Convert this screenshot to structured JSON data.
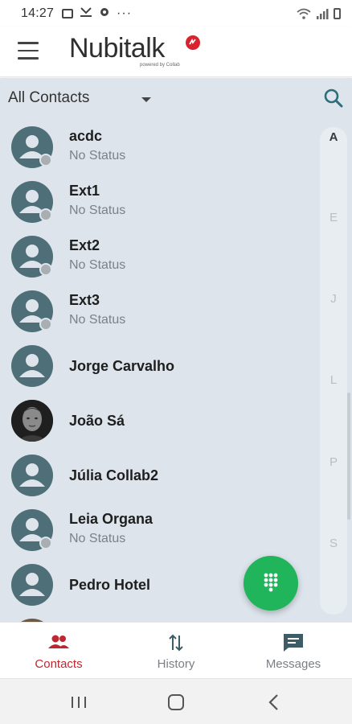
{
  "status_bar": {
    "time": "14:27",
    "more_indicator": "···"
  },
  "header": {
    "logo_text": "Nubitalk",
    "logo_tagline": "powered by Collab"
  },
  "filter": {
    "label": "All Contacts"
  },
  "contacts": [
    {
      "name": "acdc",
      "status": "No Status"
    },
    {
      "name": "Ext1",
      "status": "No Status"
    },
    {
      "name": "Ext2",
      "status": "No Status"
    },
    {
      "name": "Ext3",
      "status": "No Status"
    },
    {
      "name": "Jorge Carvalho",
      "status": ""
    },
    {
      "name": "João Sá",
      "status": ""
    },
    {
      "name": "Júlia Collab2",
      "status": ""
    },
    {
      "name": "Leia Organa",
      "status": "No Status"
    },
    {
      "name": "Pedro Hotel",
      "status": ""
    }
  ],
  "alphabet_index": [
    "A",
    "E",
    "J",
    "L",
    "P",
    "S"
  ],
  "bottom_nav": {
    "contacts": "Contacts",
    "history": "History",
    "messages": "Messages"
  },
  "colors": {
    "accent": "#c0262f",
    "fab": "#20b55a",
    "list_bg": "#dde4ec",
    "avatar": "#4f6f78"
  }
}
